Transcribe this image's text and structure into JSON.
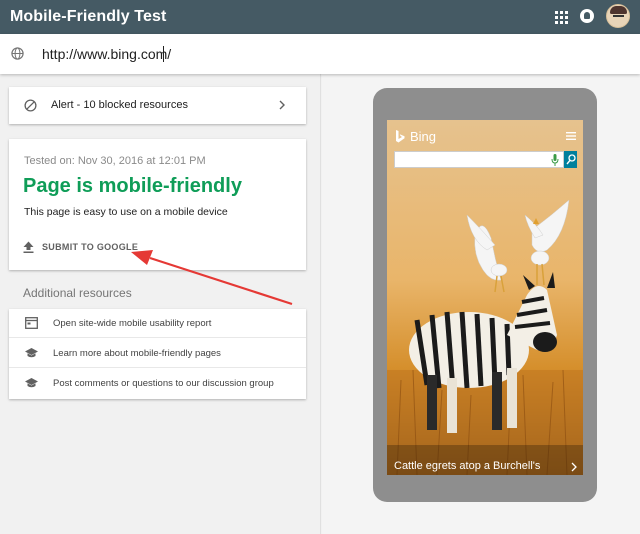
{
  "app": {
    "title": "Mobile-Friendly Test"
  },
  "header": {
    "apps_icon": "apps-grid-icon",
    "notification_icon": "notification-bell-icon",
    "avatar_icon": "user-avatar-icon"
  },
  "urlbar": {
    "value": "http://www.bing.com/",
    "icon": "globe-icon"
  },
  "alert": {
    "icon": "blocked-icon",
    "text": "Alert - 10 blocked resources",
    "chevron": "chevron-right-icon"
  },
  "result": {
    "tested_on": "Tested on: Nov 30, 2016 at 12:01 PM",
    "title": "Page is mobile-friendly",
    "description": "This page is easy to use on a mobile device",
    "submit_label": "SUBMIT TO GOOGLE",
    "submit_icon": "upload-icon",
    "title_color": "#0f9d58"
  },
  "additional": {
    "heading": "Additional resources",
    "items": [
      {
        "icon": "report-icon",
        "label": "Open site-wide mobile usability report"
      },
      {
        "icon": "school-icon",
        "label": "Learn more about mobile-friendly pages"
      },
      {
        "icon": "school-icon",
        "label": "Post comments or questions to our discussion group"
      }
    ]
  },
  "preview": {
    "site_name": "Bing",
    "caption": "Cattle egrets atop a Burchell's",
    "accent": "#00809d"
  },
  "colors": {
    "appbar": "#455a64",
    "annotation_arrow": "#e53935"
  }
}
